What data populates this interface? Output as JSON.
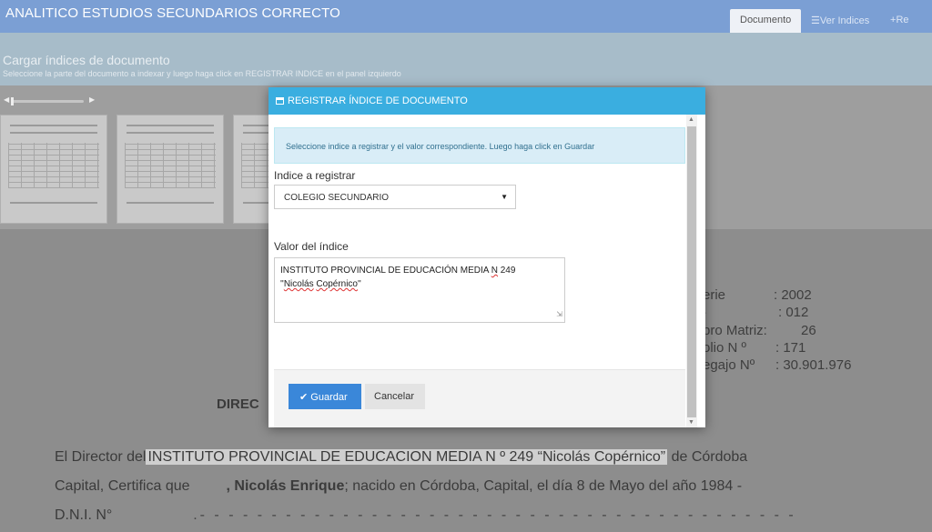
{
  "app": {
    "title": "ANALITICO ESTUDIOS SECUNDARIOS CORRECTO"
  },
  "tabs": [
    {
      "label": "Documento"
    },
    {
      "label": "Ver Indices"
    },
    {
      "label": "Re"
    }
  ],
  "page": {
    "heading": "Cargar índices de documento",
    "subheading": "Seleccione la parte del documento a indexar y luego haga click en REGISTRAR INDICE en el panel izquierdo"
  },
  "document": {
    "director_label": "DIREC",
    "right_fields": [
      {
        "label": "erie",
        "value": ": 2002"
      },
      {
        "label": "·",
        "value": ":  012"
      },
      {
        "label": "bro Matriz:",
        "value": "26"
      },
      {
        "label": "olio N º",
        "value": ":   171"
      },
      {
        "label": "egajo Nº",
        "value": ": 30.901.976"
      }
    ],
    "line1_pre": "El Director del",
    "line1_highlight": "INSTITUTO PROVINCIAL DE EDUCACION MEDIA N º 249 “Nicolás Copérnico”",
    "line1_post": " de  Córdoba",
    "line2_pre": "Capital, Certifica que ",
    "line2_bold": ", Nicolás Enrique",
    "line2_post": "; nacido en Córdoba, Capital, el día 8 de Mayo del año 1984 -",
    "line3_pre": "D.N.I. N°",
    "line3_dashes": ".- - - - - - - - - - - - - - - - - - - - - - - - - - - - - - - - - - - - - - - - - -"
  },
  "modal": {
    "title": "REGISTRAR ÍNDICE DE DOCUMENTO",
    "info": "Seleccione indice a registrar y el valor correspondiente. Luego haga click en Guardar",
    "index_label": "Indice a registrar",
    "index_selected": "COLEGIO SECUNDARIO",
    "value_label": "Valor del índice",
    "value_line1_a": "INSTITUTO PROVINCIAL DE EDUCACIÓN MEDIA ",
    "value_line1_b": "N",
    "value_line1_c": " 249",
    "value_line2_a": "''",
    "value_line2_b": "Nicolás",
    "value_line2_c": " ",
    "value_line2_d": "Copérnico",
    "value_line2_e": "''",
    "save_label": "Guardar",
    "cancel_label": "Cancelar"
  }
}
